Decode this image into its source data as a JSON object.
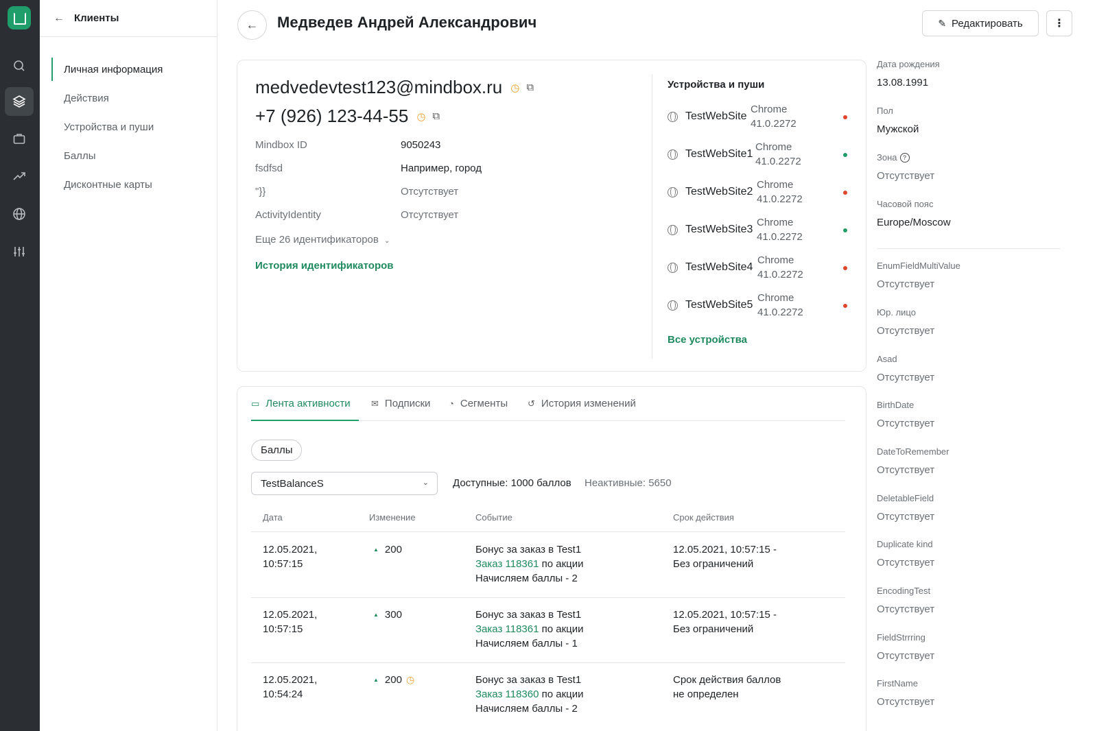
{
  "nav": {
    "back_title": "Клиенты",
    "items": [
      {
        "label": "Личная информация",
        "active": true
      },
      {
        "label": "Действия"
      },
      {
        "label": "Устройства и пуши"
      },
      {
        "label": "Баллы"
      },
      {
        "label": "Дисконтные карты"
      }
    ]
  },
  "rail_icons": [
    "search-icon",
    "layers-icon",
    "briefcase-icon",
    "trending-icon",
    "globe-icon",
    "sliders-icon"
  ],
  "header": {
    "title": "Медведев Андрей Александрович",
    "edit_label": "Редактировать",
    "more_label": "⋮"
  },
  "profile": {
    "email": "medvedevtest123@mindbox.ru",
    "phone": "+7 (926) 123-44-55",
    "fields": [
      {
        "key": "Mindbox ID",
        "value": "9050243"
      },
      {
        "key": "fsdfsd",
        "value": "Например, город"
      },
      {
        "key": "\"}}",
        "value": "Отсутствует"
      },
      {
        "key": "ActivityIdentity",
        "value": "Отсутствует"
      }
    ],
    "more_ids": "Еще 26 идентификаторов",
    "history_link": "История идентификаторов"
  },
  "devices": {
    "title": "Устройства и пуши",
    "list": [
      {
        "name": "TestWebSite",
        "browser": "Chrome",
        "version": "41.0.2272",
        "status_color": "#e0442c"
      },
      {
        "name": "TestWebSite1",
        "browser": "Chrome",
        "version": "41.0.2272",
        "status_color": "#1f9d6b"
      },
      {
        "name": "TestWebSite2",
        "browser": "Chrome",
        "version": "41.0.2272",
        "status_color": "#e0442c"
      },
      {
        "name": "TestWebSite3",
        "browser": "Chrome",
        "version": "41.0.2272",
        "status_color": "#1f9d6b"
      },
      {
        "name": "TestWebSite4",
        "browser": "Chrome",
        "version": "41.0.2272",
        "status_color": "#e0442c"
      },
      {
        "name": "TestWebSite5",
        "browser": "Chrome",
        "version": "41.0.2272",
        "status_color": "#e0442c"
      }
    ],
    "all_link": "Все устройства"
  },
  "tabs": [
    {
      "label": "Лента активности",
      "icon": "feed-icon",
      "active": true
    },
    {
      "label": "Подписки",
      "icon": "mail-icon"
    },
    {
      "label": "Сегменты",
      "icon": "pie-icon"
    },
    {
      "label": "История изменений",
      "icon": "history-icon"
    }
  ],
  "feed": {
    "chip": "Баллы",
    "balance_select": "TestBalanceS",
    "available": "Доступные: 1000 баллов",
    "inactive": "Неактивные: 5650",
    "columns": [
      "Дата",
      "Изменение",
      "Событие",
      "Срок действия"
    ],
    "rows": [
      {
        "date1": "12.05.2021,",
        "date2": "10:57:15",
        "change": "200",
        "pending": false,
        "event": "Бонус за заказ в Test1",
        "order": "Заказ 118361",
        "order_suffix": " по акции",
        "event3": "Начисляем баллы - 2",
        "exp1": "12.05.2021, 10:57:15 -",
        "exp2": "Без ограничений"
      },
      {
        "date1": "12.05.2021,",
        "date2": "10:57:15",
        "change": "300",
        "pending": false,
        "event": "Бонус за заказ в Test1",
        "order": "Заказ 118361",
        "order_suffix": " по акции",
        "event3": "Начисляем баллы - 1",
        "exp1": "12.05.2021, 10:57:15 -",
        "exp2": "Без ограничений"
      },
      {
        "date1": "12.05.2021,",
        "date2": "10:54:24",
        "change": "200",
        "pending": true,
        "event": "Бонус за заказ в Test1",
        "order": "Заказ 118360",
        "order_suffix": " по акции",
        "event3": "Начисляем баллы - 2",
        "exp1": "Срок действия баллов",
        "exp2": "не определен"
      }
    ]
  },
  "side_fields": [
    {
      "label": "Дата рождения",
      "value": "13.08.1991"
    },
    {
      "label": "Пол",
      "value": "Мужской"
    },
    {
      "label": "Зона",
      "value": "Отсутствует",
      "help": true
    },
    {
      "label": "Часовой пояс",
      "value": "Europe/Moscow"
    },
    {
      "label": "EnumFieldMultiValue",
      "value": "Отсутствует"
    },
    {
      "label": "Юр. лицо",
      "value": "Отсутствует"
    },
    {
      "label": "Asad",
      "value": "Отсутствует"
    },
    {
      "label": "BirthDate",
      "value": "Отсутствует"
    },
    {
      "label": "DateToRemember",
      "value": "Отсутствует"
    },
    {
      "label": "DeletableField",
      "value": "Отсутствует"
    },
    {
      "label": "Duplicate kind",
      "value": "Отсутствует"
    },
    {
      "label": "EncodingTest",
      "value": "Отсутствует"
    },
    {
      "label": "FieldStrrring",
      "value": "Отсутствует"
    },
    {
      "label": "FirstName",
      "value": "Отсутствует"
    }
  ],
  "colors": {
    "accent": "#1f9d6b",
    "rail": "#2b2f33",
    "warning": "#f0a030",
    "danger": "#e0442c"
  }
}
